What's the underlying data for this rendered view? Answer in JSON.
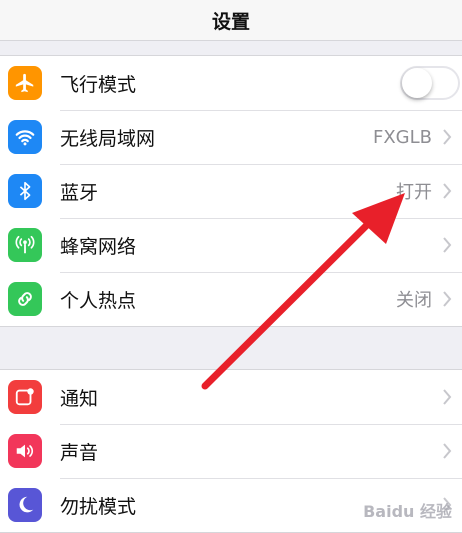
{
  "nav": {
    "title": "设置"
  },
  "group1": [
    {
      "name": "airplane",
      "label": "飞行模式",
      "icon": "airplane-icon",
      "color": "#ff9500",
      "control": "toggle",
      "toggle_on": false
    },
    {
      "name": "wifi",
      "label": "无线局域网",
      "icon": "wifi-icon",
      "color": "#1e88f5",
      "value": "FXGLB",
      "control": "chevron"
    },
    {
      "name": "bluetooth",
      "label": "蓝牙",
      "icon": "bluetooth-icon",
      "color": "#1e88f5",
      "value": "打开",
      "control": "chevron"
    },
    {
      "name": "cellular",
      "label": "蜂窝网络",
      "icon": "cellular-antenna-icon",
      "color": "#34c759",
      "value": "",
      "control": "chevron"
    },
    {
      "name": "hotspot",
      "label": "个人热点",
      "icon": "hotspot-link-icon",
      "color": "#34c759",
      "value": "关闭",
      "control": "chevron"
    }
  ],
  "group2": [
    {
      "name": "notifications",
      "label": "通知",
      "icon": "notification-icon",
      "color": "#f23d3d",
      "value": "",
      "control": "chevron"
    },
    {
      "name": "sounds",
      "label": "声音",
      "icon": "speaker-icon",
      "color": "#f2365a",
      "value": "",
      "control": "chevron"
    },
    {
      "name": "dnd",
      "label": "勿扰模式",
      "icon": "moon-icon",
      "color": "#5856d6",
      "value": "",
      "control": "chevron"
    }
  ],
  "annotation": {
    "arrow_color": "#e8202a"
  },
  "watermark": {
    "text": "Baidu 经验"
  }
}
